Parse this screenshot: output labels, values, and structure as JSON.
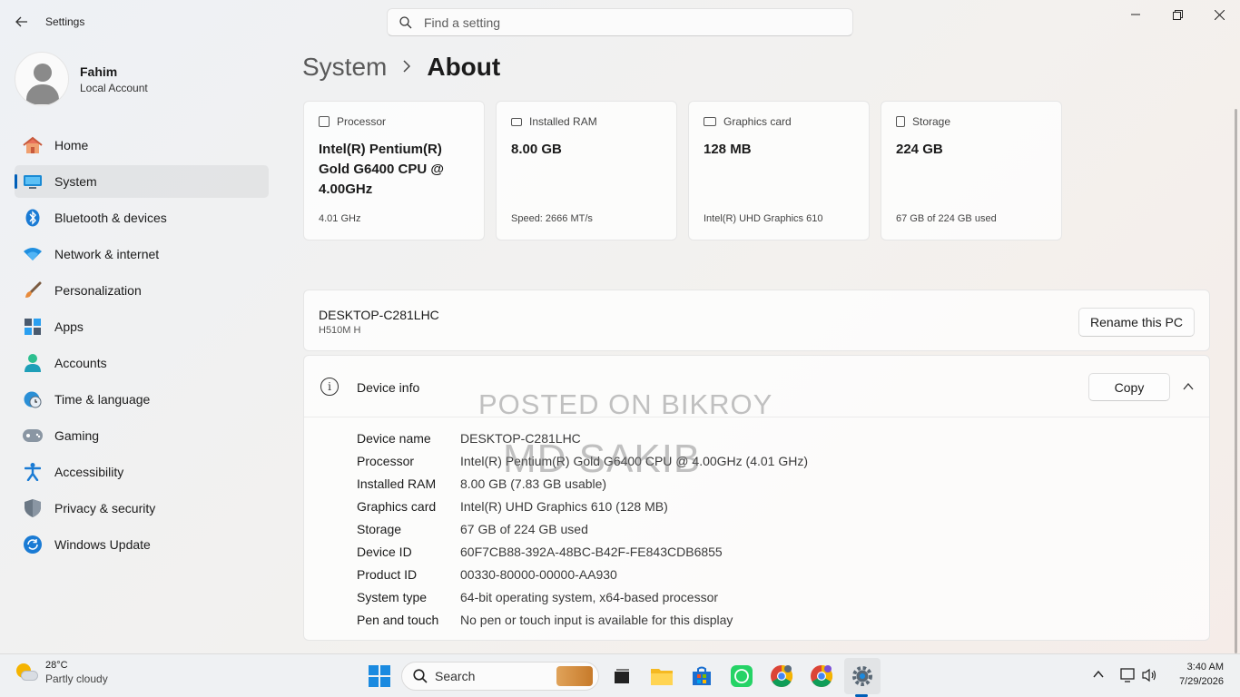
{
  "window": {
    "title": "Settings",
    "search_placeholder": "Find a setting",
    "minimize_icon": "minimize-icon",
    "maximize_icon": "restore-icon",
    "close_icon": "close-icon"
  },
  "profile": {
    "name": "Fahim",
    "account_type": "Local Account"
  },
  "sidebar": {
    "items": [
      {
        "label": "Home",
        "icon": "home-icon",
        "active": false
      },
      {
        "label": "System",
        "icon": "system-icon",
        "active": true
      },
      {
        "label": "Bluetooth & devices",
        "icon": "bluetooth-icon",
        "active": false
      },
      {
        "label": "Network & internet",
        "icon": "wifi-icon",
        "active": false
      },
      {
        "label": "Personalization",
        "icon": "brush-icon",
        "active": false
      },
      {
        "label": "Apps",
        "icon": "apps-icon",
        "active": false
      },
      {
        "label": "Accounts",
        "icon": "accounts-icon",
        "active": false
      },
      {
        "label": "Time & language",
        "icon": "globe-clock-icon",
        "active": false
      },
      {
        "label": "Gaming",
        "icon": "gamepad-icon",
        "active": false
      },
      {
        "label": "Accessibility",
        "icon": "accessibility-icon",
        "active": false
      },
      {
        "label": "Privacy & security",
        "icon": "shield-icon",
        "active": false
      },
      {
        "label": "Windows Update",
        "icon": "update-icon",
        "active": false
      }
    ]
  },
  "breadcrumb": {
    "parent": "System",
    "current": "About"
  },
  "specs": [
    {
      "label": "Processor",
      "value": "Intel(R) Pentium(R) Gold G6400 CPU @ 4.00GHz",
      "sub": "4.01 GHz"
    },
    {
      "label": "Installed RAM",
      "value": "8.00 GB",
      "sub": "Speed: 2666 MT/s"
    },
    {
      "label": "Graphics card",
      "value": "128 MB",
      "sub": "Intel(R) UHD Graphics 610"
    },
    {
      "label": "Storage",
      "value": "224 GB",
      "sub": "67 GB of 224 GB used"
    }
  ],
  "pc": {
    "name": "DESKTOP-C281LHC",
    "model": "H510M H",
    "rename_label": "Rename this PC"
  },
  "device_info": {
    "title": "Device info",
    "copy_label": "Copy",
    "rows": [
      {
        "key": "Device name",
        "value": "DESKTOP-C281LHC"
      },
      {
        "key": "Processor",
        "value": "Intel(R) Pentium(R) Gold G6400 CPU @ 4.00GHz (4.01 GHz)"
      },
      {
        "key": "Installed RAM",
        "value": "8.00 GB (7.83 GB usable)"
      },
      {
        "key": "Graphics card",
        "value": "Intel(R) UHD Graphics 610 (128 MB)"
      },
      {
        "key": "Storage",
        "value": "67 GB of 224 GB used"
      },
      {
        "key": "Device ID",
        "value": "60F7CB88-392A-48BC-B42F-FE843CDB6855"
      },
      {
        "key": "Product ID",
        "value": "00330-80000-00000-AA930"
      },
      {
        "key": "System type",
        "value": "64-bit operating system, x64-based processor"
      },
      {
        "key": "Pen and touch",
        "value": "No pen or touch input is available for this display"
      }
    ]
  },
  "watermark": {
    "line1": "POSTED ON BIKROY",
    "line2": "MD SAKIB"
  },
  "taskbar": {
    "temperature": "28°C",
    "condition": "Partly cloudy",
    "search_label": "Search",
    "time": "3:40 AM",
    "date": "7/29/2026"
  },
  "colors": {
    "accent": "#005fb8"
  }
}
